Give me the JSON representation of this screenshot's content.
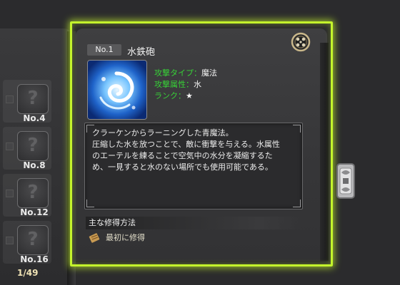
{
  "spell": {
    "number": "No.1",
    "name": "水鉄砲",
    "stats": [
      {
        "key": "攻撃タイプ",
        "sep": "：",
        "value": "魔法"
      },
      {
        "key": "攻撃属性",
        "sep": "：",
        "value": "水"
      },
      {
        "key": "ランク",
        "sep": "：",
        "value": "★"
      }
    ],
    "description": [
      "クラーケンからラーニングした青魔法。",
      "圧縮した水を放つことで、敵に衝撃を与える。水属性",
      "のエーテルを練ることで空気中の水分を凝縮するた",
      "め、一見すると水のない場所でも使用可能である。"
    ],
    "acquisition_heading": "主な修得方法",
    "acquisition_method": "最初に修得"
  },
  "sidebar": {
    "slots": [
      {
        "label": "No.4",
        "icon": "question-icon",
        "glyph": "?"
      },
      {
        "label": "No.8",
        "icon": "question-icon",
        "glyph": "?"
      },
      {
        "label": "No.12",
        "icon": "question-icon",
        "glyph": "?"
      },
      {
        "label": "No.16",
        "icon": "question-icon",
        "glyph": "?"
      }
    ],
    "page_count": "1/49"
  },
  "colors": {
    "highlight": "#c4f42c",
    "stat_key": "#37d137",
    "panel": "#3f3f41"
  },
  "icons": {
    "close": "close-icon",
    "latch": "latch-icon",
    "scroll": "scroll-icon",
    "spell": "water-cannon-icon"
  }
}
